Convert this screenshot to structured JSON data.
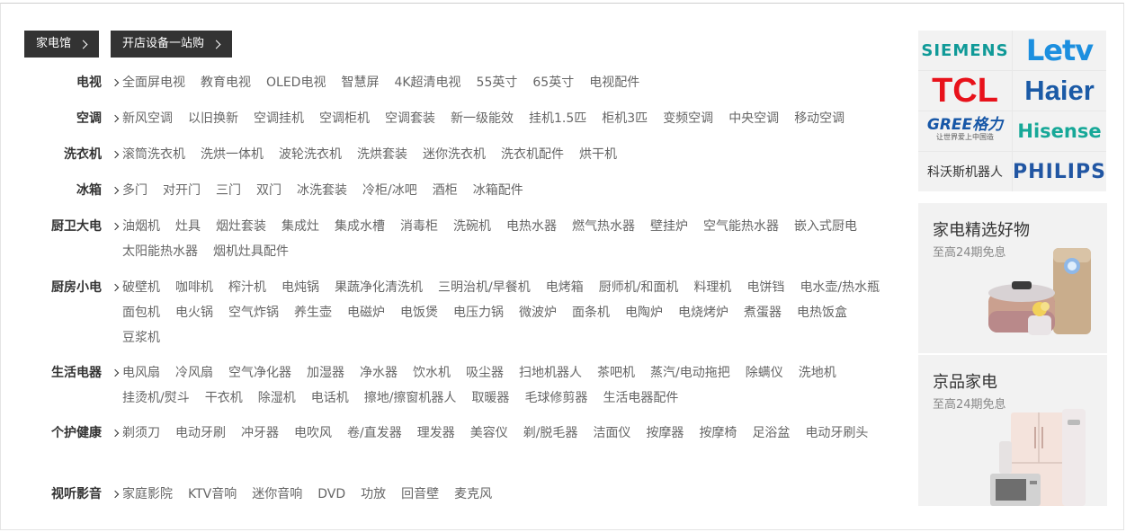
{
  "tags": [
    {
      "label": "家电馆"
    },
    {
      "label": "开店设备一站购"
    }
  ],
  "categories": [
    {
      "name": "电视",
      "items": [
        "全面屏电视",
        "教育电视",
        "OLED电视",
        "智慧屏",
        "4K超清电视",
        "55英寸",
        "65英寸",
        "电视配件"
      ]
    },
    {
      "name": "空调",
      "items": [
        "新风空调",
        "以旧换新",
        "空调挂机",
        "空调柜机",
        "空调套装",
        "新一级能效",
        "挂机1.5匹",
        "柜机3匹",
        "变频空调",
        "中央空调",
        "移动空调"
      ]
    },
    {
      "name": "洗衣机",
      "items": [
        "滚筒洗衣机",
        "洗烘一体机",
        "波轮洗衣机",
        "洗烘套装",
        "迷你洗衣机",
        "洗衣机配件",
        "烘干机"
      ]
    },
    {
      "name": "冰箱",
      "items": [
        "多门",
        "对开门",
        "三门",
        "双门",
        "冰洗套装",
        "冷柜/冰吧",
        "酒柜",
        "冰箱配件"
      ]
    },
    {
      "name": "厨卫大电",
      "items": [
        "油烟机",
        "灶具",
        "烟灶套装",
        "集成灶",
        "集成水槽",
        "消毒柜",
        "洗碗机",
        "电热水器",
        "燃气热水器",
        "壁挂炉",
        "空气能热水器",
        "嵌入式厨电",
        "太阳能热水器",
        "烟机灶具配件"
      ]
    },
    {
      "name": "厨房小电",
      "items": [
        "破壁机",
        "咖啡机",
        "榨汁机",
        "电炖锅",
        "果蔬净化清洗机",
        "三明治机/早餐机",
        "电烤箱",
        "厨师机/和面机",
        "料理机",
        "电饼铛",
        "电水壶/热水瓶",
        "面包机",
        "电火锅",
        "空气炸锅",
        "养生壶",
        "电磁炉",
        "电饭煲",
        "电压力锅",
        "微波炉",
        "面条机",
        "电陶炉",
        "电烧烤炉",
        "煮蛋器",
        "电热饭盒",
        "豆浆机"
      ]
    },
    {
      "name": "生活电器",
      "items": [
        "电风扇",
        "冷风扇",
        "空气净化器",
        "加湿器",
        "净水器",
        "饮水机",
        "吸尘器",
        "扫地机器人",
        "茶吧机",
        "蒸汽/电动拖把",
        "除螨仪",
        "洗地机",
        "挂烫机/熨斗",
        "干衣机",
        "除湿机",
        "电话机",
        "擦地/擦窗机器人",
        "取暖器",
        "毛球修剪器",
        "生活电器配件"
      ]
    },
    {
      "name": "个护健康",
      "items": [
        "剃须刀",
        "电动牙刷",
        "冲牙器",
        "电吹风",
        "卷/直发器",
        "理发器",
        "美容仪",
        "剃/脱毛器",
        "洁面仪",
        "按摩器",
        "按摩椅",
        "足浴盆",
        "电动牙刷头"
      ]
    },
    {
      "name": "视听影音",
      "items": [
        "家庭影院",
        "KTV音响",
        "迷你音响",
        "DVD",
        "功放",
        "回音壁",
        "麦克风"
      ]
    }
  ],
  "brands": [
    {
      "text": "SIEMENS",
      "icon": "siemens-logo"
    },
    {
      "text": "Letv",
      "icon": "letv-logo"
    },
    {
      "text": "TCL",
      "icon": "tcl-logo"
    },
    {
      "text": "Haier",
      "icon": "haier-logo"
    },
    {
      "text": "GREE格力",
      "sub": "让世界爱上中国造",
      "icon": "gree-logo"
    },
    {
      "text": "Hisense",
      "icon": "hisense-logo"
    },
    {
      "text": "科沃斯机器人",
      "icon": "ecovacs-logo"
    },
    {
      "text": "PHILIPS",
      "icon": "philips-logo"
    }
  ],
  "promos": [
    {
      "title": "家电精选好物",
      "subtitle": "至高24期免息"
    },
    {
      "title": "京品家电",
      "subtitle": "至高24期免息"
    }
  ]
}
